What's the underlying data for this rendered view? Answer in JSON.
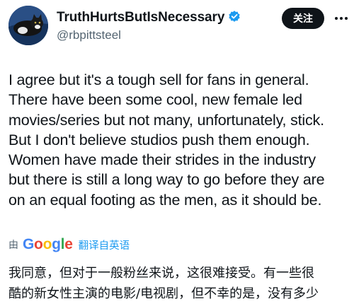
{
  "user": {
    "display_name": "TruthHurtsButIsNecessary",
    "handle": "@rbpittsteel",
    "avatar_icon": "cat-avatar",
    "verified_icon": "verified-badge-icon",
    "verified_color": "#1d9bf0"
  },
  "actions": {
    "follow_label": "关注",
    "more_icon": "more-options-icon"
  },
  "tweet": {
    "lines": [
      "I agree but it's a tough sell for fans in general.",
      "There have been some cool, new female led",
      "movies/series but not many, unfortunately, stick.",
      "But I don't believe studios push them enough.",
      "Women have made their strides in the industry",
      "but there is still a long way to go before they are",
      "on an equal footing as the men, as it should be."
    ]
  },
  "translation": {
    "by_label": "由",
    "provider": {
      "letters": [
        "G",
        "o",
        "o",
        "g",
        "l",
        "e"
      ],
      "colors": [
        "#4285f4",
        "#ea4335",
        "#fbbc05",
        "#4285f4",
        "#34a853",
        "#ea4335"
      ]
    },
    "link_label": "翻译自英语",
    "lines": [
      "我同意，但对于一般粉丝来说，这很难接受。有一些很",
      "酷的新女性主演的电影/电视剧，但不幸的是，没有多少"
    ]
  }
}
